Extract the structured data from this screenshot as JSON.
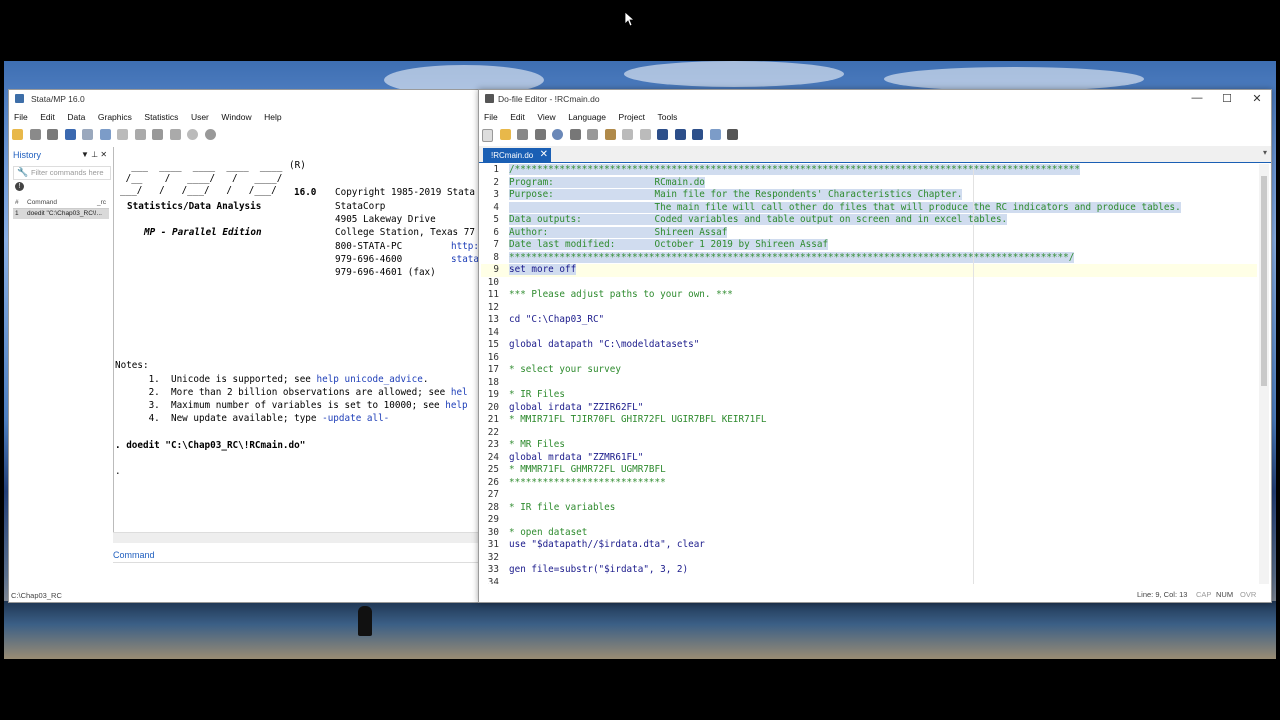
{
  "stata": {
    "title": "Stata/MP 16.0",
    "menu": [
      "File",
      "Edit",
      "Data",
      "Graphics",
      "Statistics",
      "User",
      "Window",
      "Help"
    ],
    "history": {
      "header": "History",
      "filter_placeholder": "Filter commands here",
      "col_num": "#",
      "col_command": "Command",
      "col_rc": "_rc",
      "row": {
        "num": "1",
        "command": "doedit \"C:\\Chap03_RC\\!..."
      }
    },
    "results": {
      "logo_reg": "(R)",
      "logo_top": "  ___  ____  ____  ____  ____",
      "logo_mid": " /__    /   ____/   /   ____/",
      "logo_bot": "___/   /   /___/   /   /___/",
      "version": "16.0",
      "copyright": "Copyright 1985-2019 Stata",
      "subtitle": "Statistics/Data Analysis",
      "corp": "StataCorp",
      "address1": "4905 Lakeway Drive",
      "edition": "MP - Parallel Edition",
      "address2": "College Station, Texas 77",
      "phone1": "800-STATA-PC",
      "phone1_link": "http:",
      "phone2": "979-696-4600",
      "phone2_link": "stata",
      "fax": "979-696-4601 (fax)",
      "notes_label": "Notes:",
      "note1_pre": "      1.  Unicode is supported; see ",
      "note1_link": "help unicode_advice",
      "note1_post": ".",
      "note2_pre": "      2.  More than 2 billion observations are allowed; see ",
      "note2_link": "hel",
      "note3_pre": "      3.  Maximum number of variables is set to 10000; see ",
      "note3_link": "help",
      "note4_pre": "      4.  New update available; type ",
      "note4_link": "-update all-",
      "command_echo": ". doedit \"C:\\Chap03_RC\\!RCmain.do\"",
      "prompt": "."
    },
    "command_label": "Command",
    "status_path": "C:\\Chap03_RC"
  },
  "editor": {
    "title": "Do-file Editor - !RCmain.do",
    "menu": [
      "File",
      "Edit",
      "View",
      "Language",
      "Project",
      "Tools"
    ],
    "tab_label": "!RCmain.do",
    "status": {
      "position": "Line: 9, Col: 13",
      "cap": "CAP",
      "num": "NUM",
      "ovr": "OVR"
    },
    "lines": [
      {
        "n": "1",
        "t": "/*****************************************************************************************************",
        "c": "cmt",
        "s": true
      },
      {
        "n": "2",
        "t": "Program:                  RCmain.do",
        "c": "cmt",
        "s": true
      },
      {
        "n": "3",
        "t": "Purpose:                  Main file for the Respondents' Characteristics Chapter.",
        "c": "cmt",
        "s": true
      },
      {
        "n": "4",
        "t": "                          The main file will call other do files that will produce the RC indicators and produce tables.",
        "c": "cmt",
        "s": true
      },
      {
        "n": "5",
        "t": "Data outputs:             Coded variables and table output on screen and in excel tables.",
        "c": "cmt",
        "s": true
      },
      {
        "n": "6",
        "t": "Author:                   Shireen Assaf",
        "c": "cmt",
        "s": true
      },
      {
        "n": "7",
        "t": "Date last modified:       October 1 2019 by Shireen Assaf",
        "c": "cmt",
        "s": true
      },
      {
        "n": "8",
        "t": "****************************************************************************************************/",
        "c": "cmt",
        "s": true
      },
      {
        "n": "9",
        "t": "set more off",
        "c": "kw",
        "s": true,
        "cur": true
      },
      {
        "n": "10",
        "t": "",
        "c": "",
        "s": false
      },
      {
        "n": "11",
        "t": "*** Please adjust paths to your own. ***",
        "c": "cmt",
        "s": false
      },
      {
        "n": "12",
        "t": "",
        "c": "",
        "s": false
      },
      {
        "n": "13",
        "t": "cd \"C:\\Chap03_RC\"",
        "c": "kw",
        "s": false
      },
      {
        "n": "14",
        "t": "",
        "c": "",
        "s": false
      },
      {
        "n": "15",
        "t": "global datapath \"C:\\modeldatasets\"",
        "c": "kw",
        "s": false
      },
      {
        "n": "16",
        "t": "",
        "c": "",
        "s": false
      },
      {
        "n": "17",
        "t": "* select your survey",
        "c": "cmt",
        "s": false
      },
      {
        "n": "18",
        "t": "",
        "c": "",
        "s": false
      },
      {
        "n": "19",
        "t": "* IR Files",
        "c": "cmt",
        "s": false
      },
      {
        "n": "20",
        "t": "global irdata \"ZZIR62FL\"",
        "c": "kw",
        "s": false
      },
      {
        "n": "21",
        "t": "* MMIR71FL TJIR70FL GHIR72FL UGIR7BFL KEIR71FL",
        "c": "cmt",
        "s": false
      },
      {
        "n": "22",
        "t": "",
        "c": "",
        "s": false
      },
      {
        "n": "23",
        "t": "* MR Files",
        "c": "cmt",
        "s": false
      },
      {
        "n": "24",
        "t": "global mrdata \"ZZMR61FL\"",
        "c": "kw",
        "s": false
      },
      {
        "n": "25",
        "t": "* MMMR71FL GHMR72FL UGMR7BFL",
        "c": "cmt",
        "s": false
      },
      {
        "n": "26",
        "t": "****************************",
        "c": "cmt",
        "s": false
      },
      {
        "n": "27",
        "t": "",
        "c": "",
        "s": false
      },
      {
        "n": "28",
        "t": "* IR file variables",
        "c": "cmt",
        "s": false
      },
      {
        "n": "29",
        "t": "",
        "c": "",
        "s": false
      },
      {
        "n": "30",
        "t": "* open dataset",
        "c": "cmt",
        "s": false
      },
      {
        "n": "31",
        "t": "use \"$datapath//$irdata.dta\", clear",
        "c": "kw",
        "s": false
      },
      {
        "n": "32",
        "t": "",
        "c": "",
        "s": false
      },
      {
        "n": "33",
        "t": "gen file=substr(\"$irdata\", 3, 2)",
        "c": "kw",
        "s": false
      },
      {
        "n": "34",
        "t": "",
        "c": "",
        "s": false
      }
    ]
  },
  "colors": {
    "accent": "#1a5fb4",
    "comment": "#2e8b2e",
    "selection": "#d0dcef"
  }
}
